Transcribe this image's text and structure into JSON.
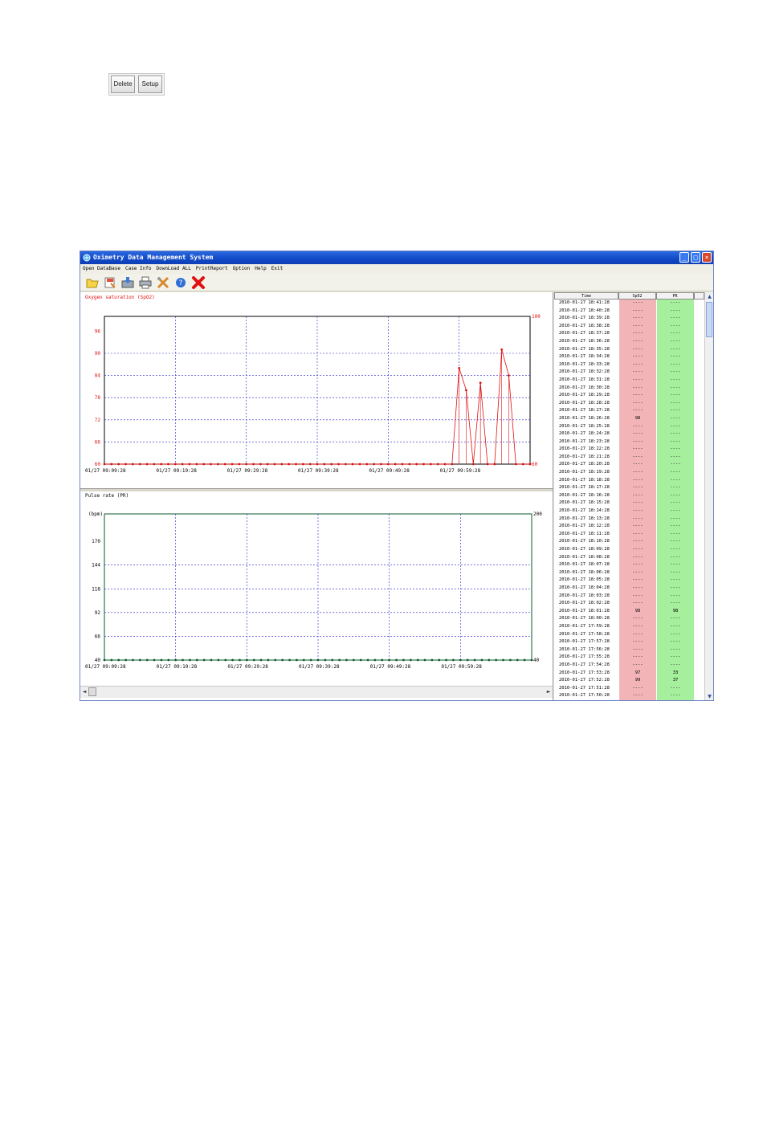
{
  "top_buttons": {
    "delete": "Delete",
    "setup": "Setup"
  },
  "window": {
    "title": "Oximetry Data Management System",
    "menu": [
      "Open DataBase",
      "Case Info",
      "DownLoad ALL",
      "PrintReport",
      "Option",
      "Help",
      "Exit"
    ],
    "toolbar_icons": [
      "open-folder-icon",
      "open-record-icon",
      "download-icon",
      "print-icon",
      "tools-icon",
      "help-icon",
      "exit-icon"
    ]
  },
  "charts": {
    "spo2_title": "Oxygen saturation (SpO2)",
    "pr_title": "Pulse rate (PR)"
  },
  "chart_data": [
    {
      "type": "line",
      "title": "Oxygen saturation (SpO2)",
      "ylabel": "",
      "yticks": [
        "96",
        "90",
        "84",
        "78",
        "72",
        "66",
        "60"
      ],
      "right_axis_labels": [
        "100",
        "60"
      ],
      "ylim": [
        60,
        100
      ],
      "xticks": [
        "01/27 09:09:28",
        "01/27 09:19:28",
        "01/27 09:29:28",
        "01/27 09:39:28",
        "01/27 09:49:28",
        "01/27 09:59:28"
      ],
      "color": "#e01010",
      "grid_color": "#2222cc",
      "axis_color": "#000000",
      "points_minutes": [
        0,
        1,
        2,
        3,
        4,
        5,
        6,
        7,
        8,
        9,
        10,
        11,
        12,
        13,
        14,
        15,
        16,
        17,
        18,
        19,
        20,
        21,
        22,
        23,
        24,
        25,
        26,
        27,
        28,
        29,
        30,
        31,
        32,
        33,
        34,
        35,
        36,
        37,
        38,
        39,
        40,
        41,
        42,
        43,
        44,
        45,
        46,
        47,
        48,
        49,
        50,
        51,
        52,
        53,
        54,
        55,
        56,
        57,
        58,
        59,
        60
      ],
      "values": [
        60,
        60,
        60,
        60,
        60,
        60,
        60,
        60,
        60,
        60,
        60,
        60,
        60,
        60,
        60,
        60,
        60,
        60,
        60,
        60,
        60,
        60,
        60,
        60,
        60,
        60,
        60,
        60,
        60,
        60,
        60,
        60,
        60,
        60,
        60,
        60,
        60,
        60,
        60,
        60,
        60,
        60,
        60,
        60,
        60,
        60,
        60,
        60,
        60,
        60,
        86,
        80,
        60,
        82,
        60,
        60,
        91,
        84,
        60,
        60,
        60
      ],
      "drop_lines_to": 60
    },
    {
      "type": "line",
      "title": "Pulse rate (PR)",
      "ylabel": "(bpm)",
      "yticks": [
        "170",
        "144",
        "118",
        "92",
        "66",
        "40"
      ],
      "right_axis_labels": [
        "200",
        "40"
      ],
      "ylim": [
        40,
        200
      ],
      "xticks": [
        "01/27 09:09:28",
        "01/27 09:19:28",
        "01/27 09:29:28",
        "01/27 09:39:28",
        "01/27 09:49:28",
        "01/27 09:59:28"
      ],
      "color": "#0a5a2a",
      "grid_color": "#2222cc",
      "axis_color": "#0a5a2a",
      "points_minutes": [
        0,
        1,
        2,
        3,
        4,
        5,
        6,
        7,
        8,
        9,
        10,
        11,
        12,
        13,
        14,
        15,
        16,
        17,
        18,
        19,
        20,
        21,
        22,
        23,
        24,
        25,
        26,
        27,
        28,
        29,
        30,
        31,
        32,
        33,
        34,
        35,
        36,
        37,
        38,
        39,
        40,
        41,
        42,
        43,
        44,
        45,
        46,
        47,
        48,
        49,
        50,
        51,
        52,
        53,
        54,
        55,
        56,
        57,
        58,
        59,
        60
      ],
      "values": [
        40,
        40,
        40,
        40,
        40,
        40,
        40,
        40,
        40,
        40,
        40,
        40,
        40,
        40,
        40,
        40,
        40,
        40,
        40,
        40,
        40,
        40,
        40,
        40,
        40,
        40,
        40,
        40,
        40,
        40,
        40,
        40,
        40,
        40,
        40,
        40,
        40,
        40,
        40,
        40,
        40,
        40,
        40,
        40,
        40,
        40,
        40,
        40,
        40,
        40,
        40,
        40,
        40,
        40,
        40,
        40,
        40,
        40,
        40,
        40,
        40
      ]
    }
  ],
  "table": {
    "headers": [
      "Time",
      "SpO2",
      "PR"
    ],
    "rows": [
      [
        "2010-01-27 18:41:28",
        "----",
        "----"
      ],
      [
        "2010-01-27 18:40:28",
        "----",
        "----"
      ],
      [
        "2010-01-27 18:39:28",
        "----",
        "----"
      ],
      [
        "2010-01-27 18:38:28",
        "----",
        "----"
      ],
      [
        "2010-01-27 18:37:28",
        "----",
        "----"
      ],
      [
        "2010-01-27 18:36:28",
        "----",
        "----"
      ],
      [
        "2010-01-27 18:35:28",
        "----",
        "----"
      ],
      [
        "2010-01-27 18:34:28",
        "----",
        "----"
      ],
      [
        "2010-01-27 18:33:28",
        "----",
        "----"
      ],
      [
        "2010-01-27 18:32:28",
        "----",
        "----"
      ],
      [
        "2010-01-27 18:31:28",
        "----",
        "----"
      ],
      [
        "2010-01-27 18:30:28",
        "----",
        "----"
      ],
      [
        "2010-01-27 18:29:28",
        "----",
        "----"
      ],
      [
        "2010-01-27 18:28:28",
        "----",
        "----"
      ],
      [
        "2010-01-27 18:27:28",
        "----",
        "----"
      ],
      [
        "2010-01-27 18:26:28",
        "98",
        "----"
      ],
      [
        "2010-01-27 18:25:28",
        "----",
        "----"
      ],
      [
        "2010-01-27 18:24:28",
        "----",
        "----"
      ],
      [
        "2010-01-27 18:23:28",
        "----",
        "----"
      ],
      [
        "2010-01-27 18:22:28",
        "----",
        "----"
      ],
      [
        "2010-01-27 18:21:28",
        "----",
        "----"
      ],
      [
        "2010-01-27 18:20:28",
        "----",
        "----"
      ],
      [
        "2010-01-27 18:19:28",
        "----",
        "----"
      ],
      [
        "2010-01-27 18:18:28",
        "----",
        "----"
      ],
      [
        "2010-01-27 18:17:28",
        "----",
        "----"
      ],
      [
        "2010-01-27 18:16:28",
        "----",
        "----"
      ],
      [
        "2010-01-27 18:15:28",
        "----",
        "----"
      ],
      [
        "2010-01-27 18:14:28",
        "----",
        "----"
      ],
      [
        "2010-01-27 18:13:28",
        "----",
        "----"
      ],
      [
        "2010-01-27 18:12:28",
        "----",
        "----"
      ],
      [
        "2010-01-27 18:11:28",
        "----",
        "----"
      ],
      [
        "2010-01-27 18:10:28",
        "----",
        "----"
      ],
      [
        "2010-01-27 18:09:28",
        "----",
        "----"
      ],
      [
        "2010-01-27 18:08:28",
        "----",
        "----"
      ],
      [
        "2010-01-27 18:07:28",
        "----",
        "----"
      ],
      [
        "2010-01-27 18:06:28",
        "----",
        "----"
      ],
      [
        "2010-01-27 18:05:28",
        "----",
        "----"
      ],
      [
        "2010-01-27 18:04:28",
        "----",
        "----"
      ],
      [
        "2010-01-27 18:03:28",
        "----",
        "----"
      ],
      [
        "2010-01-27 18:02:28",
        "----",
        "----"
      ],
      [
        "2010-01-27 18:01:28",
        "98",
        "98"
      ],
      [
        "2010-01-27 18:00:28",
        "----",
        "----"
      ],
      [
        "2010-01-27 17:59:28",
        "----",
        "----"
      ],
      [
        "2010-01-27 17:58:28",
        "----",
        "----"
      ],
      [
        "2010-01-27 17:57:28",
        "----",
        "----"
      ],
      [
        "2010-01-27 17:56:28",
        "----",
        "----"
      ],
      [
        "2010-01-27 17:55:28",
        "----",
        "----"
      ],
      [
        "2010-01-27 17:54:28",
        "----",
        "----"
      ],
      [
        "2010-01-27 17:53:28",
        "97",
        "33"
      ],
      [
        "2010-01-27 17:52:28",
        "99",
        "37"
      ],
      [
        "2010-01-27 17:51:28",
        "----",
        "----"
      ],
      [
        "2010-01-27 17:50:28",
        "----",
        "----"
      ]
    ]
  }
}
